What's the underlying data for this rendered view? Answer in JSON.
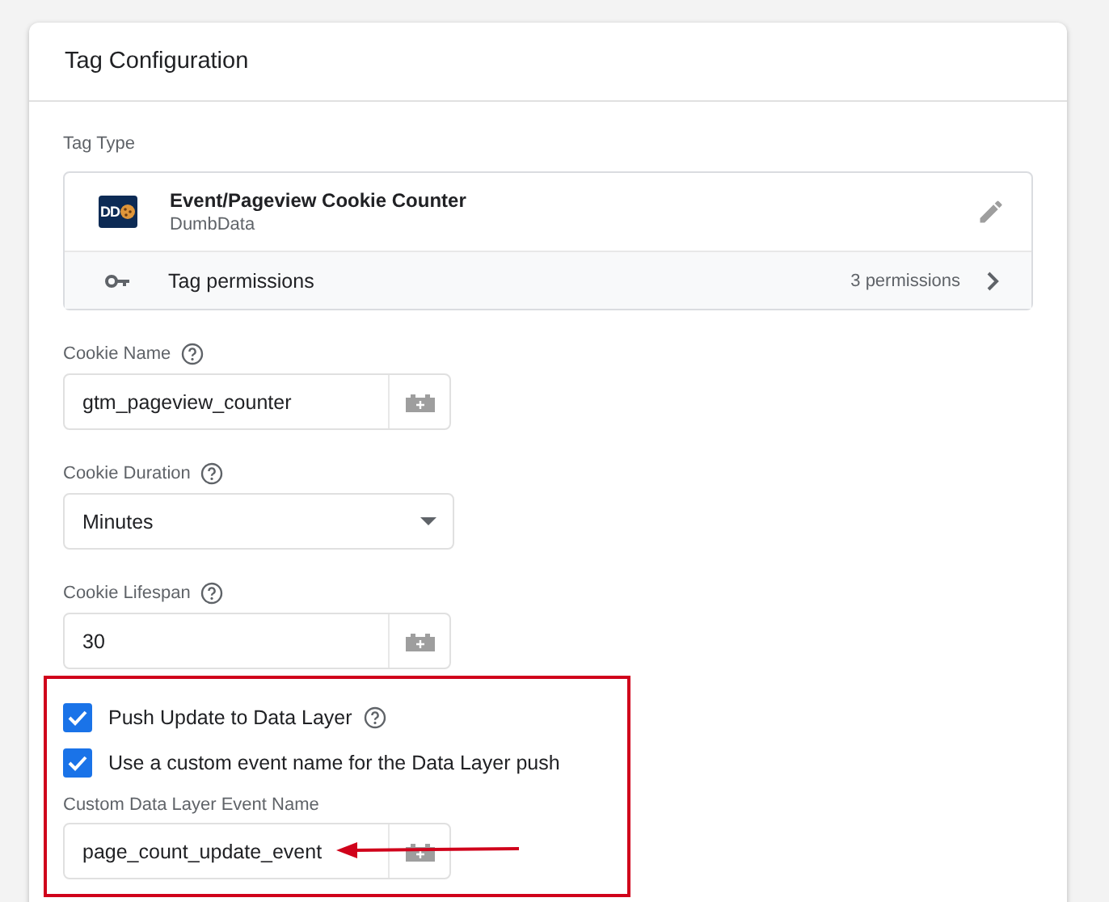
{
  "card": {
    "title": "Tag Configuration"
  },
  "tag_type": {
    "label": "Tag Type",
    "name": "Event/Pageview Cookie Counter",
    "vendor": "DumbData",
    "logo_text": "DD",
    "permissions_label": "Tag permissions",
    "permissions_count": "3 permissions"
  },
  "fields": [
    {
      "kind": "text",
      "label": "Cookie Name",
      "help": true,
      "value": "gtm_pageview_counter"
    },
    {
      "kind": "select",
      "label": "Cookie Duration",
      "help": true,
      "value": "Minutes"
    },
    {
      "kind": "text",
      "label": "Cookie Lifespan",
      "help": true,
      "value": "30"
    }
  ],
  "highlighted_fields": [
    {
      "kind": "checkbox",
      "label": "Push Update to Data Layer",
      "help": true,
      "checked": true
    },
    {
      "kind": "checkbox",
      "label": "Use a custom event name for the Data Layer push",
      "help": false,
      "checked": true
    },
    {
      "kind": "text",
      "label": "Custom Data Layer Event Name",
      "help": false,
      "value": "page_count_update_event",
      "arrow": true
    }
  ]
}
